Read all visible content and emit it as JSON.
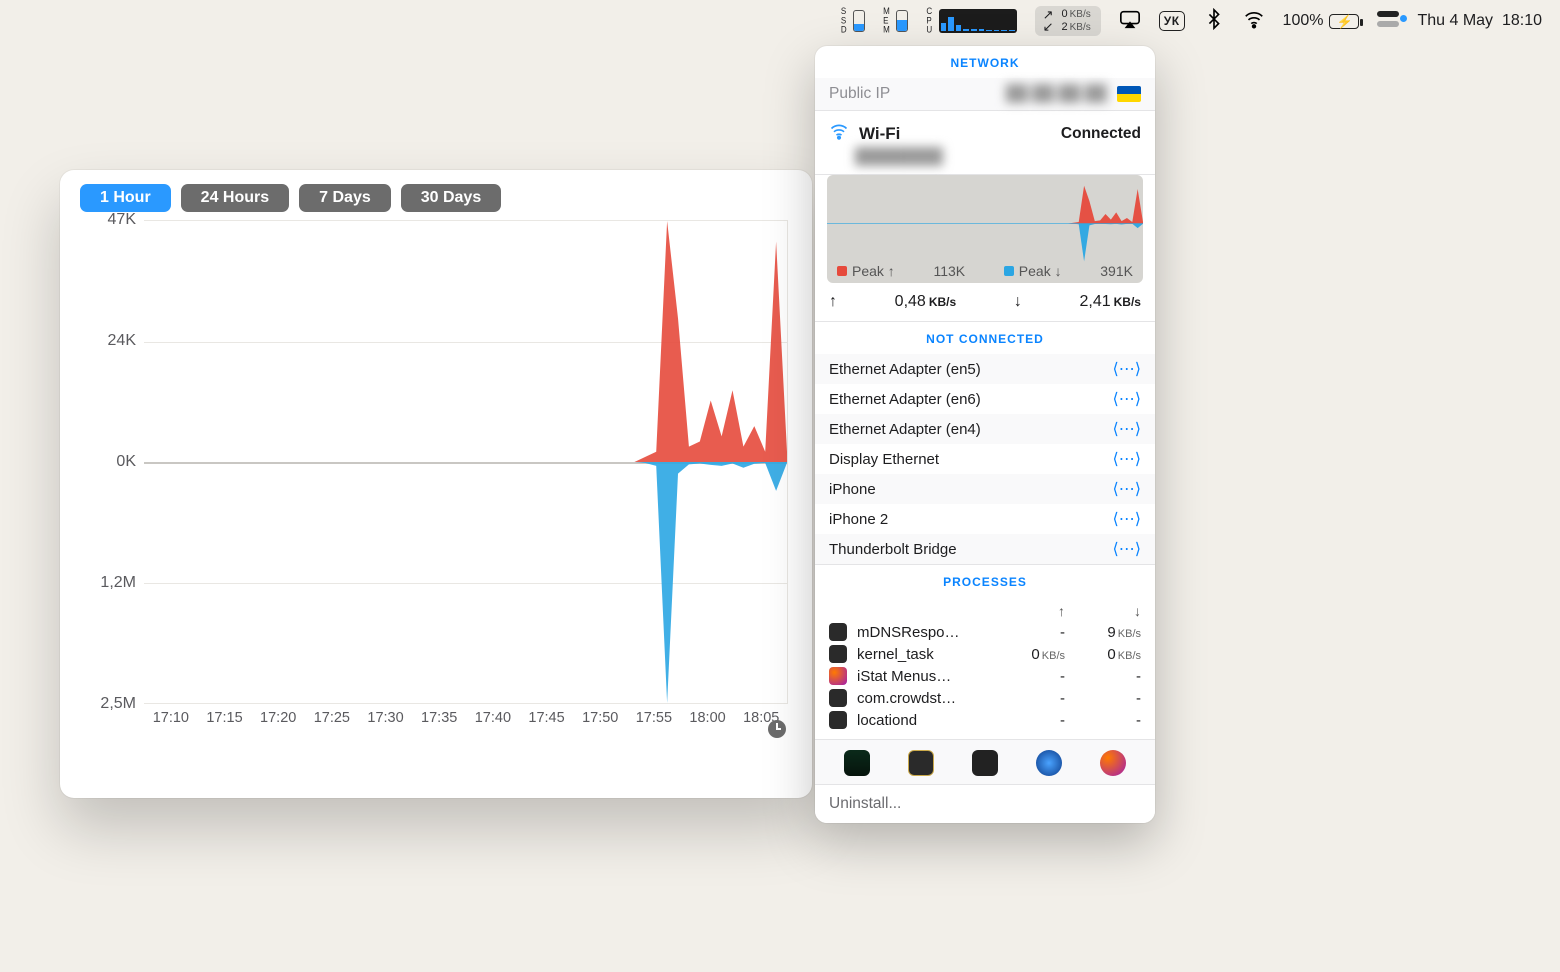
{
  "menubar": {
    "ssd_label": "SSD",
    "mem_label": "MEM",
    "cpu_label": "CPU",
    "net_up": "0",
    "net_down": "2",
    "net_unit": "KB/s",
    "lang": "УК",
    "battery_pct": "100%",
    "date": "Thu 4 May",
    "time": "18:10"
  },
  "tabs": [
    "1 Hour",
    "24 Hours",
    "7 Days",
    "30 Days"
  ],
  "active_tab": 0,
  "chart": {
    "x_ticks": [
      "17:10",
      "17:15",
      "17:20",
      "17:25",
      "17:30",
      "17:35",
      "17:40",
      "17:45",
      "17:50",
      "17:55",
      "18:00",
      "18:05"
    ],
    "y_ticks_up": [
      {
        "label": "47K",
        "pct": 0
      },
      {
        "label": "24K",
        "pct": 25
      },
      {
        "label": "0K",
        "pct": 50
      }
    ],
    "y_ticks_down": [
      {
        "label": "1,2M",
        "pct": 75
      },
      {
        "label": "2,5M",
        "pct": 100
      }
    ]
  },
  "chart_data": {
    "type": "area",
    "title": "",
    "xlabel": "",
    "ylabel": "",
    "x_count": 60,
    "y_up_max": 47,
    "y_down_max": 2500,
    "upload_series_K": [
      0,
      0,
      0,
      0,
      0,
      0,
      0,
      0,
      0,
      0,
      0,
      0,
      0,
      0,
      0,
      0,
      0,
      0,
      0,
      0,
      0,
      0,
      0,
      0,
      0,
      0,
      0,
      0,
      0,
      0,
      0,
      0,
      0,
      0,
      0,
      0,
      0,
      0,
      0,
      0,
      0,
      0,
      0,
      0,
      0,
      0,
      1,
      2,
      47,
      28,
      3,
      4,
      12,
      5,
      14,
      3,
      7,
      2,
      43,
      2
    ],
    "download_series_K": [
      0,
      0,
      0,
      0,
      0,
      0,
      0,
      0,
      0,
      0,
      0,
      0,
      0,
      0,
      0,
      0,
      0,
      0,
      0,
      0,
      0,
      0,
      0,
      0,
      0,
      0,
      0,
      0,
      0,
      0,
      0,
      0,
      0,
      0,
      0,
      0,
      0,
      0,
      0,
      0,
      0,
      0,
      0,
      0,
      0,
      0,
      10,
      40,
      2500,
      120,
      25,
      15,
      30,
      40,
      15,
      60,
      18,
      10,
      300,
      8
    ]
  },
  "popover": {
    "title": "NETWORK",
    "public_ip_label": "Public IP",
    "public_ip_value": "██.██.██.██",
    "wifi": {
      "name": "Wi-Fi",
      "ssid": "████████",
      "status": "Connected",
      "peak_up_label": "Peak ↑",
      "peak_up": "113K",
      "peak_down_label": "Peak ↓",
      "peak_down": "391K",
      "rate_up": "0,48",
      "rate_down": "2,41",
      "rate_unit": "KB/s"
    },
    "not_connected_title": "NOT CONNECTED",
    "not_connected": [
      "Ethernet Adapter (en5)",
      "Ethernet Adapter (en6)",
      "Ethernet Adapter (en4)",
      "Display Ethernet",
      "iPhone",
      "iPhone 2",
      "Thunderbolt Bridge"
    ],
    "processes_title": "PROCESSES",
    "processes": [
      {
        "name": "mDNSRespo…",
        "up": "-",
        "down": "9",
        "down_unit": "KB/s",
        "icon": "dark"
      },
      {
        "name": "kernel_task",
        "up": "0",
        "up_unit": "KB/s",
        "down": "0",
        "down_unit": "KB/s",
        "icon": "dark"
      },
      {
        "name": "iStat Menus…",
        "up": "-",
        "down": "-",
        "icon": "istat"
      },
      {
        "name": "com.crowdst…",
        "up": "-",
        "down": "-",
        "icon": "dark"
      },
      {
        "name": "locationd",
        "up": "-",
        "down": "-",
        "icon": "dark"
      }
    ],
    "uninstall": "Uninstall..."
  }
}
